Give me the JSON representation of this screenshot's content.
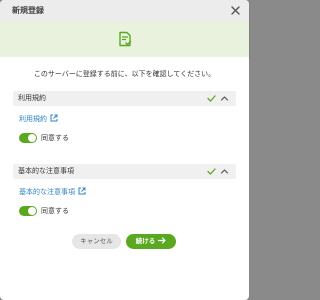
{
  "dialog": {
    "title": "新規登録",
    "intro": "このサーバーに登録する前に、以下を確認してください。"
  },
  "sections": [
    {
      "title": "利用規約",
      "link": "利用規約",
      "toggle_label": "同意する",
      "agreed": true
    },
    {
      "title": "基本的な注意事項",
      "link": "基本的な注意事項",
      "toggle_label": "同意する",
      "agreed": true
    }
  ],
  "buttons": {
    "cancel": "キャンセル",
    "continue": "続ける"
  },
  "colors": {
    "accent": "#5aa81f",
    "banner": "#e8f2dd",
    "link": "#2d84c6"
  },
  "icons": {
    "close": "close-icon",
    "banner": "document-check-icon",
    "check": "check-icon",
    "collapse": "chevron-up-icon",
    "external": "external-link-icon",
    "arrow": "arrow-right-icon"
  }
}
